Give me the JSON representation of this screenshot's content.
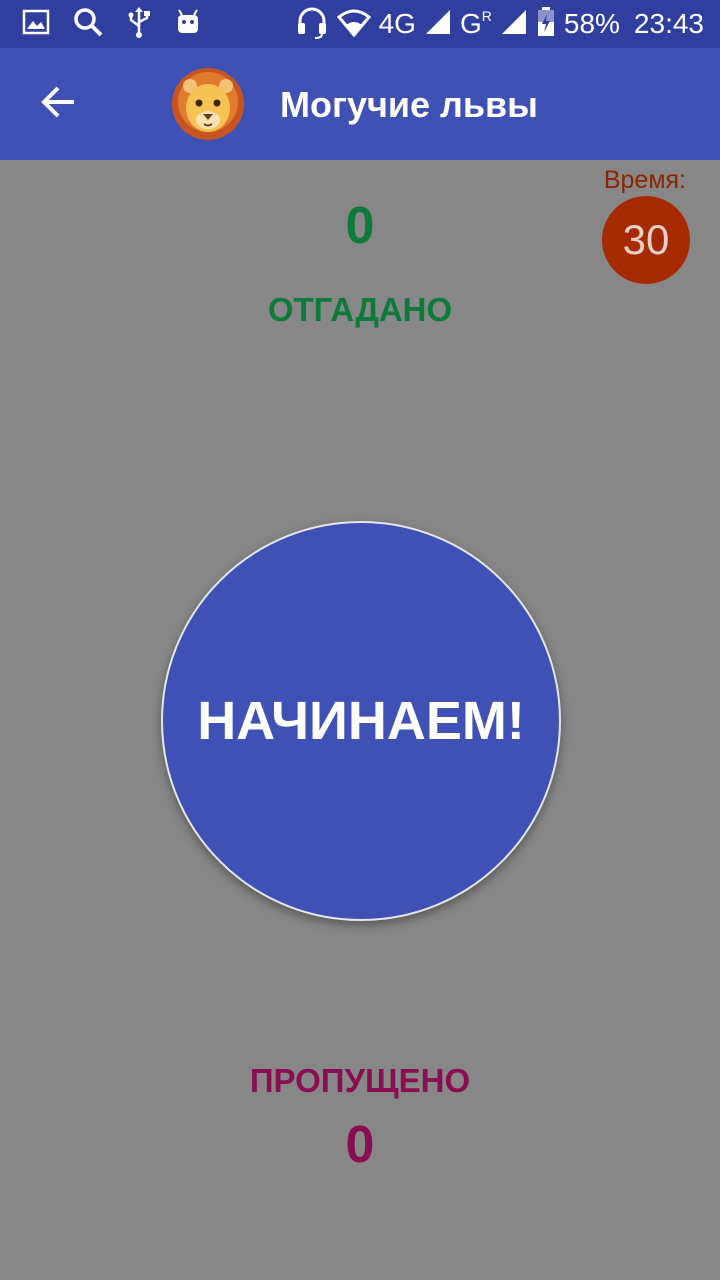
{
  "status_bar": {
    "battery": "58%",
    "time": "23:43",
    "network": "4G",
    "network2": "G",
    "roaming": "R",
    "icons": [
      "gallery-icon",
      "search-icon",
      "usb-icon",
      "android-icon",
      "headset-icon",
      "wifi-icon",
      "signal-icon",
      "signal-icon",
      "battery-icon"
    ]
  },
  "app_bar": {
    "title": "Могучие львы",
    "back_icon": "arrow-back-icon",
    "team_icon": "lion-icon"
  },
  "timer": {
    "label": "Время:",
    "value": "30"
  },
  "guessed": {
    "count": "0",
    "label": "ОТГАДАНО"
  },
  "start_button": {
    "label": "НАЧИНАЕМ!"
  },
  "skipped": {
    "label": "ПРОПУЩЕНО",
    "count": "0"
  },
  "colors": {
    "status_bar": "#303F9F",
    "app_bar": "#3F51B5",
    "background": "#878787",
    "guessed": "#0E7A3A",
    "skipped": "#880E4F",
    "timer": "#A52A00"
  }
}
